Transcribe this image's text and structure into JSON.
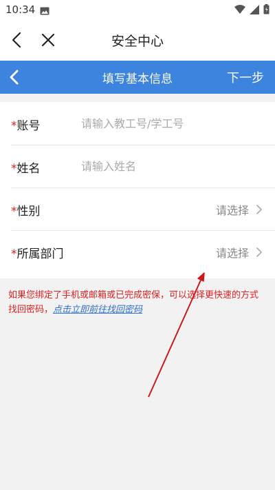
{
  "status_bar": {
    "time": "10:34"
  },
  "webview": {
    "title": "安全中心"
  },
  "nav": {
    "title": "填写基本信息",
    "next_label": "下一步"
  },
  "form": {
    "account": {
      "label": "账号",
      "placeholder": "请输入教工号/学工号"
    },
    "name": {
      "label": "姓名",
      "placeholder": "请输入姓名"
    },
    "gender": {
      "label": "性别",
      "value": "请选择"
    },
    "department": {
      "label": "所属部门",
      "value": "请选择"
    },
    "required_mark": "*"
  },
  "notice": {
    "text": "如果您绑定了手机或邮箱或已完成密保，可以选择更快速的方式找回密码，",
    "link": "点击立即前往找回密码"
  },
  "colors": {
    "primary": "#3d84de",
    "required": "#e02020",
    "link": "#2f6fd8",
    "annotation_arrow": "#cc1a1a"
  }
}
